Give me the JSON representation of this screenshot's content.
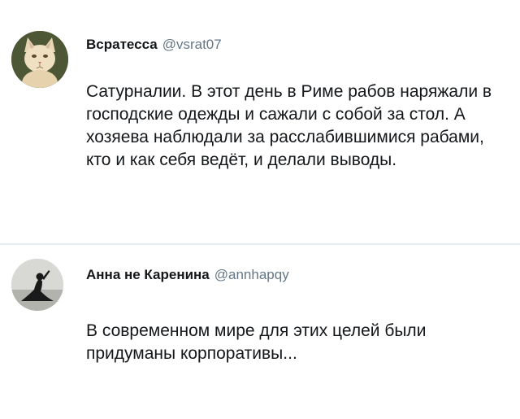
{
  "tweets": [
    {
      "display_name": "Всратесса",
      "handle": "@vsrat07",
      "text": "Сатурналии. В этот день в Риме рабов наряжали в господские одежды и сажали с собой за стол. А хозяева наблюдали за расслабившимися рабами, кто и как себя ведёт, и делали выводы.",
      "avatar_icon": "cat-portrait-avatar"
    },
    {
      "display_name": "Анна не Каренина",
      "handle": "@annhapqy",
      "text": "В современном мире для этих целей были придуманы корпоративы...",
      "avatar_icon": "person-silhouette-avatar"
    }
  ],
  "colors": {
    "text": "#14171a",
    "handle": "#657786",
    "divider": "#e6ecf0"
  }
}
